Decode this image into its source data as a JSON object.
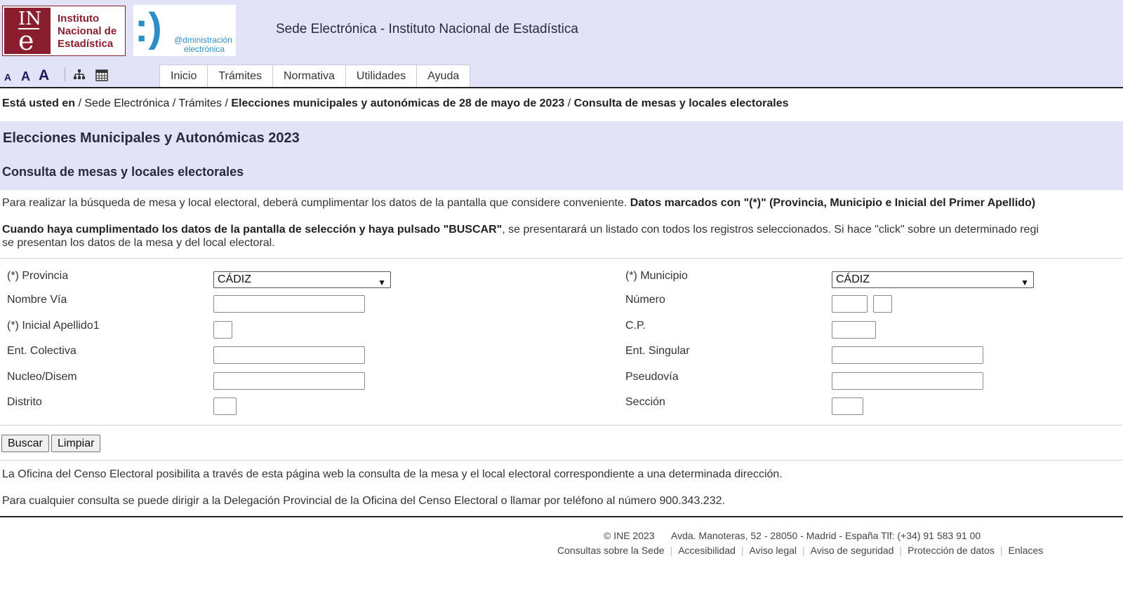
{
  "header": {
    "ine_logo": {
      "mark_top": "IN",
      "mark_bottom": "e",
      "line1": "Instituto",
      "line2": "Nacional de",
      "line3": "Estadística"
    },
    "admin_logo": {
      "smile": ":)",
      "line1": "@dministración",
      "line2": "electrónica"
    },
    "site_title": "Sede Electrónica - Instituto Nacional de Estadística",
    "font_sizes": [
      "A",
      "A",
      "A"
    ],
    "tool_icons": [
      "sitemap-icon",
      "calendar-icon"
    ]
  },
  "nav": {
    "tabs": [
      "Inicio",
      "Trámites",
      "Normativa",
      "Utilidades",
      "Ayuda"
    ]
  },
  "breadcrumb": {
    "label": "Está usted en",
    "items": [
      "Sede Electrónica",
      "Trámites",
      "Elecciones municipales y autonómicas de 28 de mayo de 2023",
      "Consulta de mesas y locales electorales"
    ]
  },
  "page": {
    "title": "Elecciones Municipales y Autonómicas 2023",
    "subtitle": "Consulta de mesas y locales electorales"
  },
  "intro": {
    "p1_text": "Para realizar la búsqueda de mesa y local electoral, deberá cumplimentar los datos de la pantalla que considere conveniente.",
    "p1_bold": "Datos marcados con \"(*)\" (Provincia, Municipio e Inicial del Primer Apellido)",
    "p2_bold": "Cuando haya cumplimentado los datos de la pantalla de selección y haya pulsado \"BUSCAR\"",
    "p2_text": ", se presentarará un listado con todos los registros seleccionados. Si hace \"click\" sobre un determinado regi",
    "p3_text": "se presentan los datos de la mesa y del local electoral."
  },
  "form": {
    "provincia": {
      "label": "(*) Provincia",
      "value": "CÁDIZ"
    },
    "municipio": {
      "label": "(*) Municipio",
      "value": "CÁDIZ"
    },
    "nombre_via": {
      "label": "Nombre Vía",
      "value": ""
    },
    "numero": {
      "label": "Número",
      "value": ""
    },
    "inicial_apellido": {
      "label": "(*) Inicial Apellido1",
      "value": ""
    },
    "cp": {
      "label": "C.P.",
      "value": ""
    },
    "ent_colectiva": {
      "label": "Ent. Colectiva",
      "value": ""
    },
    "ent_singular": {
      "label": "Ent. Singular",
      "value": ""
    },
    "nucleo": {
      "label": "Nucleo/Disem",
      "value": ""
    },
    "pseudovia": {
      "label": "Pseudovía",
      "value": ""
    },
    "distrito": {
      "label": "Distrito",
      "value": ""
    },
    "seccion": {
      "label": "Sección",
      "value": ""
    },
    "buscar_label": "Buscar",
    "limpiar_label": "Limpiar"
  },
  "notes": {
    "n1": "La Oficina del Censo Electoral posibilita a través de esta página web la consulta de la mesa y el local electoral correspondiente a una determinada dirección.",
    "n2": "Para cualquier consulta se puede dirigir a la Delegación Provincial de la Oficina del Censo Electoral o llamar por teléfono al número 900.343.232."
  },
  "footer": {
    "copyright": "©  INE 2023",
    "address": "Avda. Manoteras, 52 - 28050 - Madrid - España Tlf: (+34) 91 583 91 00",
    "links": [
      "Consultas sobre la Sede",
      "Accesibilidad",
      "Aviso legal",
      "Aviso de seguridad",
      "Protección de datos",
      "Enlaces"
    ]
  }
}
